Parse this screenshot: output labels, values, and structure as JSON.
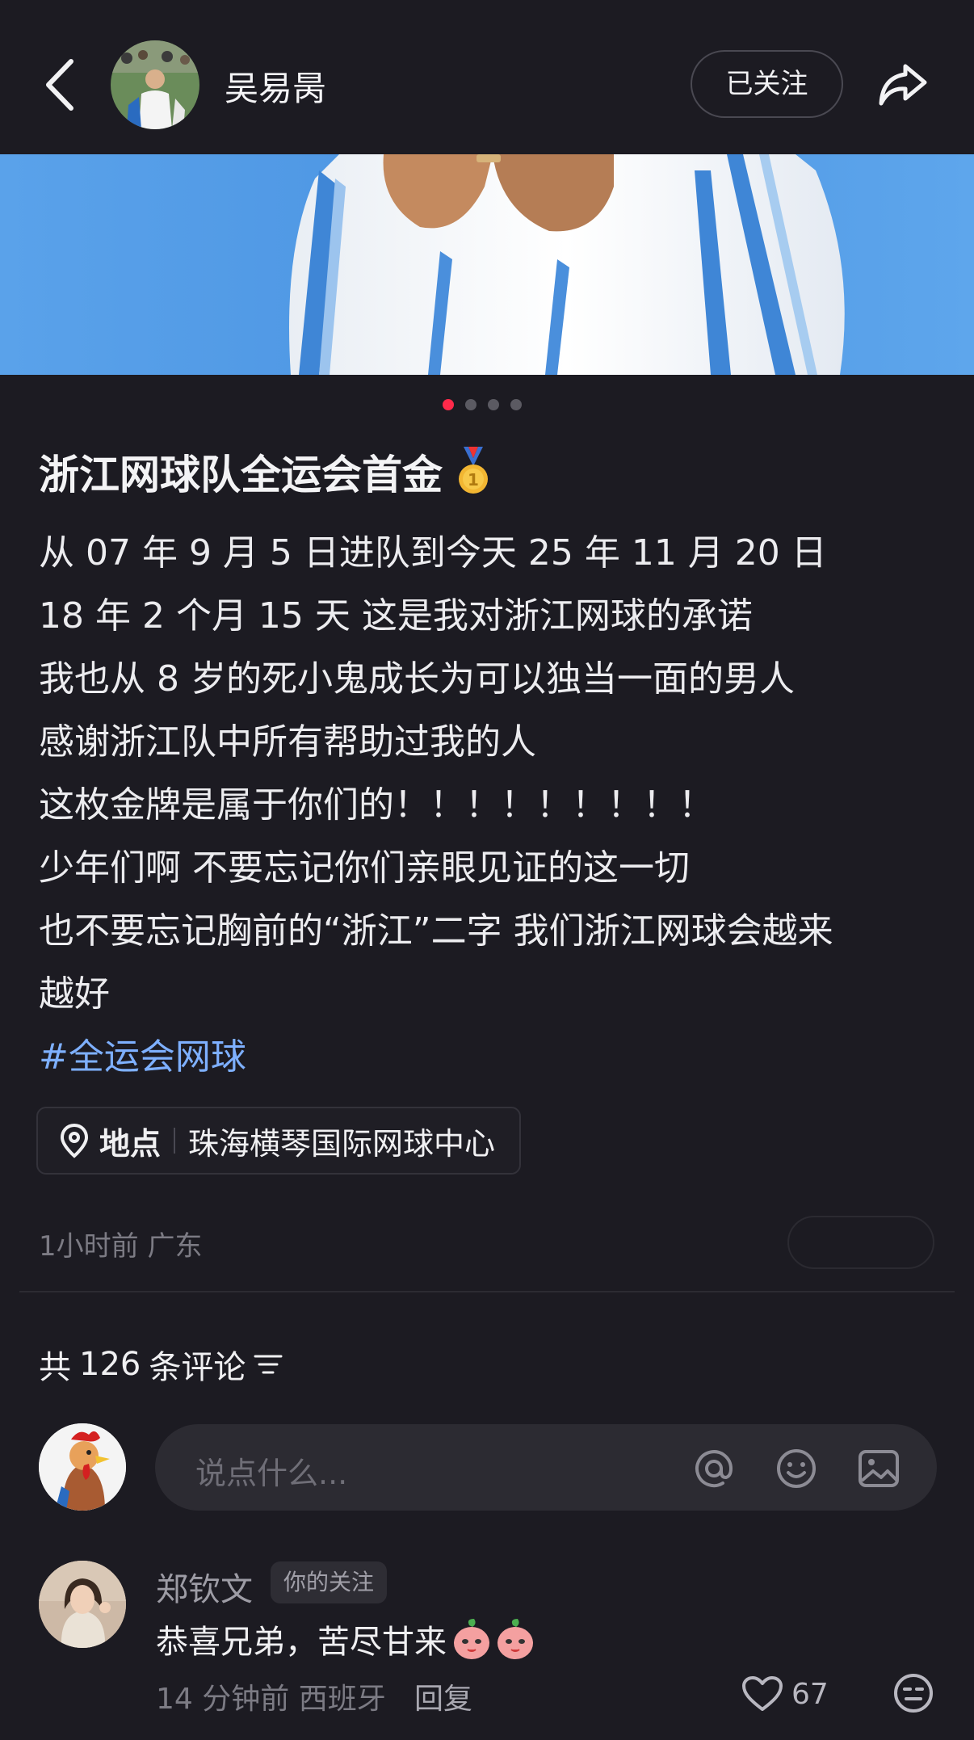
{
  "header": {
    "author_name": "吴易昺",
    "follow_label": "已关注"
  },
  "carousel": {
    "total": 4,
    "active": 1
  },
  "post": {
    "title": "浙江网球队全运会首金",
    "lines": [
      "从 07 年 9 月 5 日进队到今天 25 年 11 月 20 日",
      "18 年 2 个月 15 天 这是我对浙江网球的承诺",
      "我也从 8 岁的死小鬼成长为可以独当一面的男人",
      "感谢浙江队中所有帮助过我的人",
      "这枚金牌是属于你们的！！！！！！！！！",
      "少年们啊 不要忘记你们亲眼见证的这一切",
      "也不要忘记胸前的“浙江”二字 我们浙江网球会越来",
      "越好"
    ],
    "hashtag": "#全运会网球",
    "location_label": "地点",
    "location_name": "珠海横琴国际网球中心",
    "time": "1小时前",
    "region": "广东"
  },
  "comments": {
    "total_prefix": "共",
    "total_count": "126",
    "total_suffix": "条评论",
    "input_placeholder": "说点什么...",
    "items": [
      {
        "name": "郑钦文",
        "badge": "你的关注",
        "text": "恭喜兄弟，苦尽甘来",
        "time": "14 分钟前",
        "region": "西班牙",
        "reply_label": "回复",
        "likes": "67"
      }
    ]
  },
  "colors": {
    "background": "#1c1b22",
    "accent_red": "#ff2a4a",
    "hashtag_blue": "#7eb0ff",
    "muted_text": "#7c7b84"
  }
}
